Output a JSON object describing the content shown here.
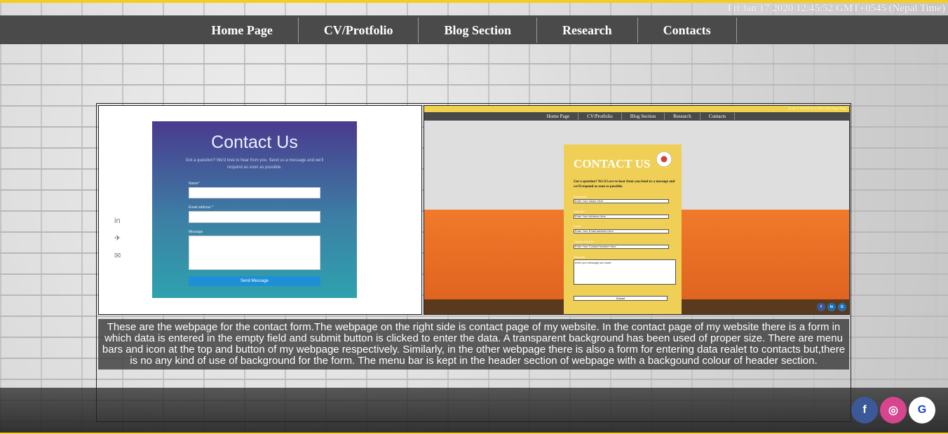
{
  "clock": "Fri Jan 17 2020 12:45:52 GMT+0545 (Nepal Time)",
  "nav": {
    "items": [
      {
        "label": "Home Page"
      },
      {
        "label": "CV/Protfolio"
      },
      {
        "label": "Blog Section"
      },
      {
        "label": "Research"
      },
      {
        "label": "Contacts"
      }
    ]
  },
  "left_screenshot": {
    "title": "Contact Us",
    "subtitle": "Got a question? We'd love to hear from you. Send us a message and we'll respond as soon as possible.",
    "name_label": "Name*",
    "email_label": "Email address *",
    "message_label": "Message",
    "button": "Send Message",
    "icons": [
      "linkedin-icon",
      "twitter-icon",
      "mail-icon"
    ]
  },
  "right_screenshot": {
    "clock": "Fri Jan 17 2020 09:45:24 GMT+0545 (Nepal Time)",
    "nav": [
      "Home Page",
      "CV/Protfolio",
      "Blog Section",
      "Research",
      "Contacts"
    ],
    "title": "CONTACT US",
    "description": "Got a question? We'd Love to hear from you.Send us a message and we'll respond as soon as possible.",
    "fields": [
      {
        "label": "Full Name:",
        "placeholder": "Enter Your Name Here"
      },
      {
        "label": "Address:",
        "placeholder": "Enter Your Address Here"
      },
      {
        "label": "Email:",
        "placeholder": "Enter Your Email address Here"
      },
      {
        "label": "Contact Number:",
        "placeholder": "Enter Your Contact Number Here"
      }
    ],
    "message_label": "Remarks:",
    "message_placeholder": "enter you message you want",
    "submit": "Submit",
    "social": [
      "f",
      "in",
      "G"
    ]
  },
  "caption": "These are the webpage for the contact form.The webpage on the right side is contact page of my website. In the contact page of my website there is a form in which data is entered in the empty field and submit button is clicked to enter the data. A transparent background has been used of proper size. There are menu bars and icon at the top and button of my webpage respectively. Similarly, in the other webpage there is also a form for entering data realet to contacts but,there is no any kind of use of background for the form. The menu bar is kept in the header section of webpage with a backgound colour of header section.",
  "social": {
    "facebook": "f",
    "instagram": "◎",
    "google": "G",
    "colors": {
      "facebook": "#3b5998",
      "instagram": "#d6458d",
      "google": "#ffffff"
    }
  }
}
